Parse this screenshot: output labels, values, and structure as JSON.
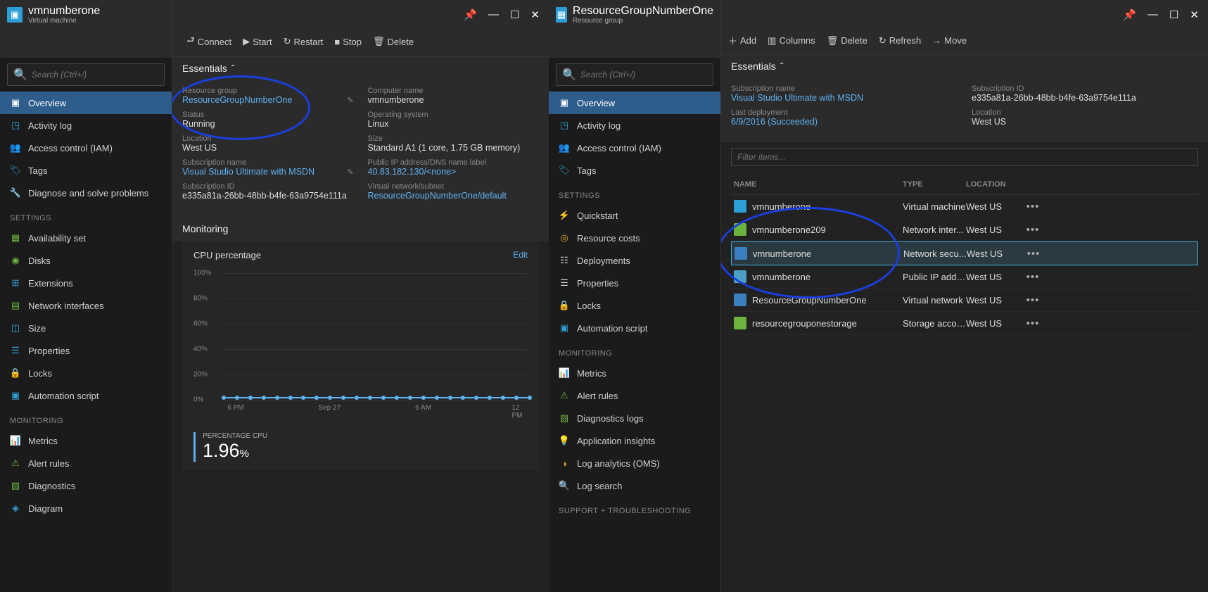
{
  "left": {
    "header": {
      "title": "vmnumberone",
      "subtitle": "Virtual machine"
    },
    "toolbar": {
      "connect": "Connect",
      "start": "Start",
      "restart": "Restart",
      "stop": "Stop",
      "delete": "Delete"
    },
    "search_placeholder": "Search (Ctrl+/)",
    "nav": {
      "overview": "Overview",
      "activity": "Activity log",
      "access": "Access control (IAM)",
      "tags": "Tags",
      "diagnose": "Diagnose and solve problems"
    },
    "section_settings": "SETTINGS",
    "settings_items": {
      "avail": "Availability set",
      "disks": "Disks",
      "ext": "Extensions",
      "nics": "Network interfaces",
      "size": "Size",
      "props": "Properties",
      "locks": "Locks",
      "auto": "Automation script"
    },
    "section_monitoring": "MONITORING",
    "monitoring_items": {
      "metrics": "Metrics",
      "alerts": "Alert rules",
      "diag": "Diagnostics",
      "diagram": "Diagram"
    },
    "essentials_label": "Essentials",
    "essentials": {
      "rg_label": "Resource group",
      "rg_val": "ResourceGroupNumberOne",
      "status_label": "Status",
      "status_val": "Running",
      "loc_label": "Location",
      "loc_val": "West US",
      "sub_label": "Subscription name",
      "sub_val": "Visual Studio Ultimate with MSDN",
      "subid_label": "Subscription ID",
      "subid_val": "e335a81a-26bb-48bb-b4fe-63a9754e111a",
      "comp_label": "Computer name",
      "comp_val": "vmnumberone",
      "os_label": "Operating system",
      "os_val": "Linux",
      "size_label": "Size",
      "size_val": "Standard A1 (1 core, 1.75 GB memory)",
      "ip_label": "Public IP address/DNS name label",
      "ip_val": "40.83.182.130/<none>",
      "vnet_label": "Virtual network/subnet",
      "vnet_val": "ResourceGroupNumberOne/default"
    },
    "monitoring_head": "Monitoring",
    "chart": {
      "title": "CPU percentage",
      "edit": "Edit",
      "footer_label": "PERCENTAGE CPU",
      "footer_value": "1.96",
      "footer_unit": "%"
    }
  },
  "right": {
    "header": {
      "title": "ResourceGroupNumberOne",
      "subtitle": "Resource group"
    },
    "toolbar": {
      "add": "Add",
      "columns": "Columns",
      "delete": "Delete",
      "refresh": "Refresh",
      "move": "Move"
    },
    "search_placeholder": "Search (Ctrl+/)",
    "nav": {
      "overview": "Overview",
      "activity": "Activity log",
      "access": "Access control (IAM)",
      "tags": "Tags"
    },
    "section_settings": "SETTINGS",
    "settings_items": {
      "quick": "Quickstart",
      "costs": "Resource costs",
      "deploy": "Deployments",
      "props": "Properties",
      "locks": "Locks",
      "auto": "Automation script"
    },
    "section_monitoring": "MONITORING",
    "monitoring_items": {
      "metrics": "Metrics",
      "alerts": "Alert rules",
      "diag": "Diagnostics logs",
      "appins": "Application insights",
      "oms": "Log analytics (OMS)",
      "logsearch": "Log search"
    },
    "section_support": "SUPPORT + TROUBLESHOOTING",
    "essentials_label": "Essentials",
    "essentials": {
      "sub_label": "Subscription name",
      "sub_val": "Visual Studio Ultimate with MSDN",
      "dep_label": "Last deployment",
      "dep_val": "6/9/2016 (Succeeded)",
      "subid_label": "Subscription ID",
      "subid_val": "e335a81a-26bb-48bb-b4fe-63a9754e111a",
      "loc_label": "Location",
      "loc_val": "West US"
    },
    "filter_placeholder": "Filter items...",
    "table": {
      "head_name": "NAME",
      "head_type": "TYPE",
      "head_loc": "LOCATION",
      "rows": [
        {
          "name": "vmnumberone",
          "type": "Virtual machine",
          "loc": "West US",
          "color": "#2e9fd6"
        },
        {
          "name": "vmnumberone209",
          "type": "Network inter...",
          "loc": "West US",
          "color": "#6cb33f"
        },
        {
          "name": "vmnumberone",
          "type": "Network secu...",
          "loc": "West US",
          "color": "#3a7fbf",
          "selected": true
        },
        {
          "name": "vmnumberone",
          "type": "Public IP addr...",
          "loc": "West US",
          "color": "#4aa0c8"
        },
        {
          "name": "ResourceGroupNumberOne",
          "type": "Virtual network",
          "loc": "West US",
          "color": "#3a7fbf"
        },
        {
          "name": "resourcegrouponestorage",
          "type": "Storage accou...",
          "loc": "West US",
          "color": "#6cb33f"
        }
      ]
    }
  },
  "chart_data": {
    "type": "line",
    "title": "CPU percentage",
    "ylabel": "%",
    "ylim": [
      0,
      100
    ],
    "y_ticks": [
      "100%",
      "80%",
      "60%",
      "40%",
      "20%",
      "0%"
    ],
    "x_ticks": [
      "6 PM",
      "Sep 27",
      "6 AM",
      "12 PM"
    ],
    "series": [
      {
        "name": "PERCENTAGE CPU",
        "color": "#5fb2f2",
        "values": [
          2,
          2,
          2,
          2,
          2,
          2,
          2,
          2,
          2,
          2,
          2,
          2,
          2,
          2,
          2,
          2,
          2,
          2,
          2,
          2,
          2,
          2,
          2,
          2
        ]
      }
    ],
    "current_value": 1.96
  }
}
